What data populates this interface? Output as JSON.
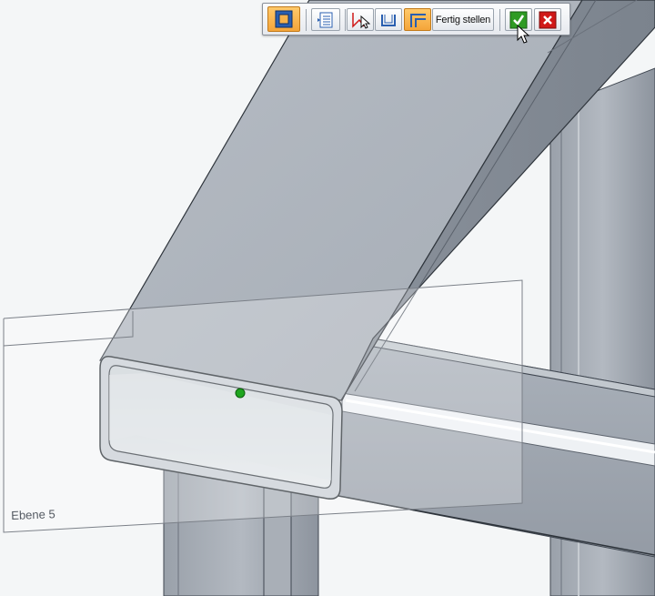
{
  "toolbar": {
    "buttons": [
      {
        "icon": "profile-frame-icon",
        "state": "active"
      },
      {
        "icon": "options-list-icon",
        "state": "normal"
      },
      {
        "icon": "select-cursor-icon",
        "state": "normal"
      },
      {
        "icon": "u-profile-icon",
        "state": "normal"
      },
      {
        "icon": "corner-trim-icon",
        "state": "active"
      }
    ],
    "finish_label": "Fertig stellen",
    "accept_icon": "checkmark-icon",
    "cancel_icon": "close-icon"
  },
  "viewport": {
    "plane_label": "Ebene 5"
  },
  "colors": {
    "active_button": "#f4a53a",
    "accept_green": "#2e9b23",
    "cancel_red": "#d01818",
    "keypoint_green": "#1fa51f",
    "steel": "#a9b0b9"
  }
}
